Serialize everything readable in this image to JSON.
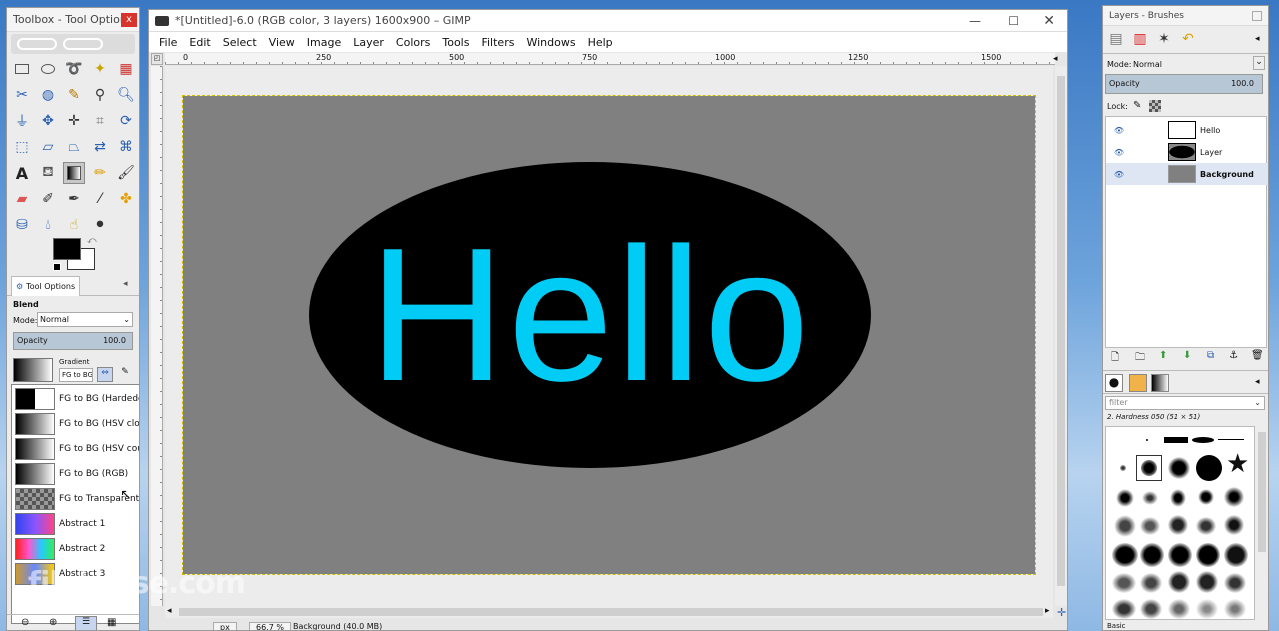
{
  "toolbox": {
    "title": "Toolbox - Tool Options",
    "close": "x",
    "tool_options_tab": "Tool Options",
    "section": "Blend",
    "mode_label": "Mode:",
    "mode_value": "Normal",
    "opacity_label": "Opacity",
    "opacity_value": "100.0",
    "gradient_label": "Gradient",
    "gradient_value": "FG to BG",
    "gradients": [
      "FG to BG (Hardedge)",
      "FG to BG (HSV clockwise hue)",
      "FG to BG (HSV counter-clockwise)",
      "FG to BG (RGB)",
      "FG to Transparent",
      "Abstract 1",
      "Abstract 2",
      "Abstract 3"
    ]
  },
  "main": {
    "title": "*[Untitled]-6.0 (RGB color, 3 layers) 1600x900 – GIMP",
    "menus": [
      "File",
      "Edit",
      "Select",
      "View",
      "Image",
      "Layer",
      "Colors",
      "Tools",
      "Filters",
      "Windows",
      "Help"
    ],
    "ruler_ticks": [
      "0",
      "250",
      "500",
      "750",
      "1000",
      "1250",
      "1500"
    ],
    "canvas_text": "Hello",
    "status_unit": "px",
    "status_zoom": "66.7 %",
    "status_text": "Background (40.0 MB)"
  },
  "layers": {
    "title": "Layers - Brushes",
    "mode_label": "Mode:",
    "mode_value": "Normal",
    "opacity_label": "Opacity",
    "opacity_value": "100.0",
    "lock_label": "Lock:",
    "items": [
      "Hello",
      "Layer",
      "Background"
    ],
    "filter_placeholder": "filter",
    "brush_name": "2. Hardness 050 (51 × 51)",
    "brush_footer": "Basic"
  },
  "watermark": "filehorse.com",
  "colors": {
    "canvas_bg": "#808080",
    "ellipse": "#000000",
    "text": "#00ccf5"
  }
}
